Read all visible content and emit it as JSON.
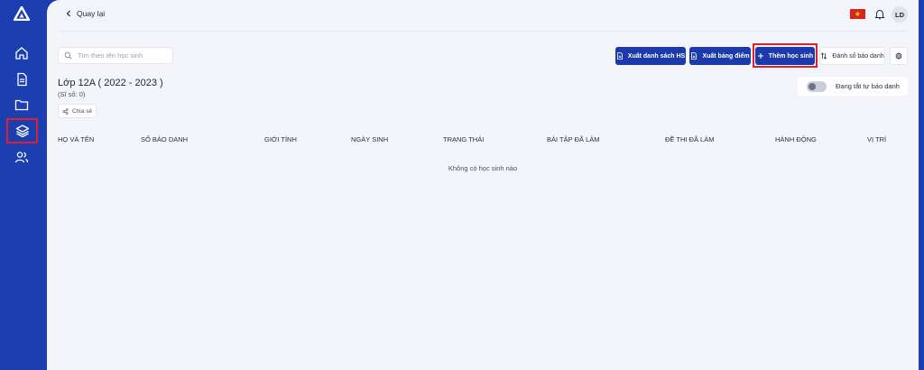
{
  "header": {
    "back_label": "Quay lại",
    "flag_icon": "flag-vn-icon",
    "avatar_initials": "LD"
  },
  "toolbar": {
    "search_placeholder": "Tìm theo tên học sinh",
    "export_students_label": "Xuất danh sách HS",
    "export_scores_label": "Xuất bảng điểm",
    "add_student_label": "Thêm học sinh",
    "numbering_label": "Đánh số báo danh"
  },
  "class_info": {
    "title": "Lớp 12A ( 2022 - 2023 )",
    "student_count": "(Sĩ số: 0)",
    "share_label": "Chia sẻ"
  },
  "auto_numbering": {
    "label": "Đang tắt tự báo danh",
    "enabled": false
  },
  "table": {
    "columns": [
      "HỌ VÀ TÊN",
      "SỐ BÁO DANH",
      "GIỚI TÍNH",
      "NGÀY SINH",
      "TRẠNG THÁI",
      "BÀI TẬP ĐÃ LÀM",
      "ĐỀ THI ĐÃ LÀM",
      "HÀNH ĐỘNG",
      "VỊ TRÍ"
    ],
    "empty_message": "Không có học sinh nào"
  },
  "colors": {
    "brand": "#1b3fb0",
    "primary_button": "#1c3aa9",
    "highlight": "#e0202a",
    "background": "#f3f5fa"
  },
  "sidebar": {
    "items": [
      {
        "icon": "home-icon",
        "active": false
      },
      {
        "icon": "document-icon",
        "active": false
      },
      {
        "icon": "folder-icon",
        "active": false
      },
      {
        "icon": "layers-icon",
        "active": true
      },
      {
        "icon": "users-icon",
        "active": false
      }
    ]
  }
}
